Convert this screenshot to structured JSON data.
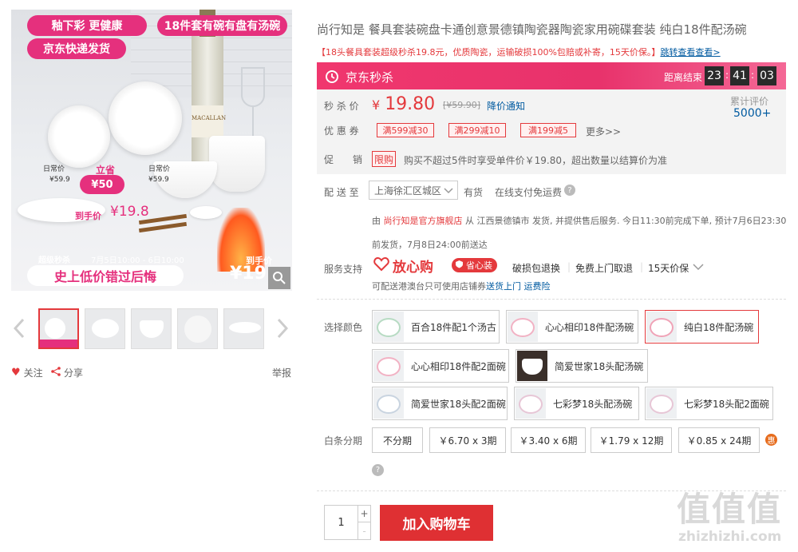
{
  "gallery": {
    "badge_top_left": "釉下彩 更健康",
    "badge_top_right": "18件套有碗有盘有汤碗",
    "badge_jd": "京东快递发货",
    "price_tag_left_label": "日常价",
    "price_tag_left_value": "¥59.9",
    "price_tag_right_label": "日常价",
    "price_tag_right_value": "¥59.9",
    "save_label": "立省",
    "save_value": "¥50",
    "to_hand_label": "到手价",
    "to_hand_value": "¥19.8",
    "promo_line": "超级秒杀",
    "promo_dates": "7月5日10:00 - 6日10:00",
    "promo_slogan": "史上低价错过后悔",
    "fire_label": "到手价",
    "fire_value": "¥19",
    "bottle_text": "MACALLAN"
  },
  "actions": {
    "follow": "关注",
    "share": "分享",
    "report": "举报"
  },
  "product": {
    "title": "尚行知是 餐具套装碗盘卡通创意景德镇陶瓷器陶瓷家用碗碟套装 纯白18件配汤碗",
    "subtitle": "【18头餐具套装超级秒杀19.8元，优质陶瓷，运输破损100%包赔或补寄，15天价保。】",
    "subtitle_link": "跳转查看查看>"
  },
  "seckill": {
    "label": "京东秒杀",
    "ends_label": "距离结束",
    "hours": "23",
    "minutes": "41",
    "seconds": "03"
  },
  "price": {
    "label": "秒 杀 价",
    "currency": "¥",
    "value": "19.80",
    "original": "[¥59.90]",
    "notify": "降价通知",
    "review_label": "累计评价",
    "review_count": "5000+"
  },
  "coupons": {
    "label": "优 惠 券",
    "items": [
      "满599减30",
      "满299减10",
      "满199减5"
    ],
    "more": "更多>>"
  },
  "promotion": {
    "label": "促　　销",
    "tag": "限购",
    "text": "购买不超过5件时享受单件价￥19.80，超出数量以结算价为准"
  },
  "delivery": {
    "label": "配 送 至",
    "location": "上海徐汇区城区",
    "stock": "有货",
    "payment": "在线支付免运费",
    "from_prefix": "由",
    "shop": "尚行知是官方旗舰店",
    "detail": "从 江西景德镇市 发货, 并提供售后服务. 今日11:30前完成下单, 预计7月6日23:30前发货，7月8日24:00前送达"
  },
  "service": {
    "label": "服务支持",
    "brand": "放心购",
    "badge": "省心装",
    "items": [
      "破损包退换",
      "免费上门取退",
      "15天价保"
    ],
    "note": "可配送港澳台只可使用店铺券",
    "note_link1": "送货上门",
    "note_link2": "运费险"
  },
  "colors": {
    "label": "选择颜色",
    "options": [
      "百合18件配1个汤古",
      "心心相印18件配汤碗",
      "纯白18件配汤碗",
      "心心相印18件配2面碗",
      "简爱世家18头配汤碗",
      "简爱世家18头配2面碗",
      "七彩梦18头配汤碗",
      "七彩梦18头配2面碗"
    ]
  },
  "installment": {
    "label": "白条分期",
    "options": [
      "不分期",
      "￥6.70 x 3期",
      "￥3.40 x 6期",
      "￥1.79 x 12期",
      "￥0.85 x 24期"
    ],
    "badge": "惠"
  },
  "cart": {
    "quantity": "1",
    "plus": "+",
    "minus": "-",
    "add_label": "加入购物车"
  },
  "watermark": {
    "text": "值值值",
    "domain": "zhizhizhi.com"
  },
  "palette": {
    "accent": "#e4393c",
    "seckill_bg": "#e8326b",
    "link": "#005aa0"
  }
}
